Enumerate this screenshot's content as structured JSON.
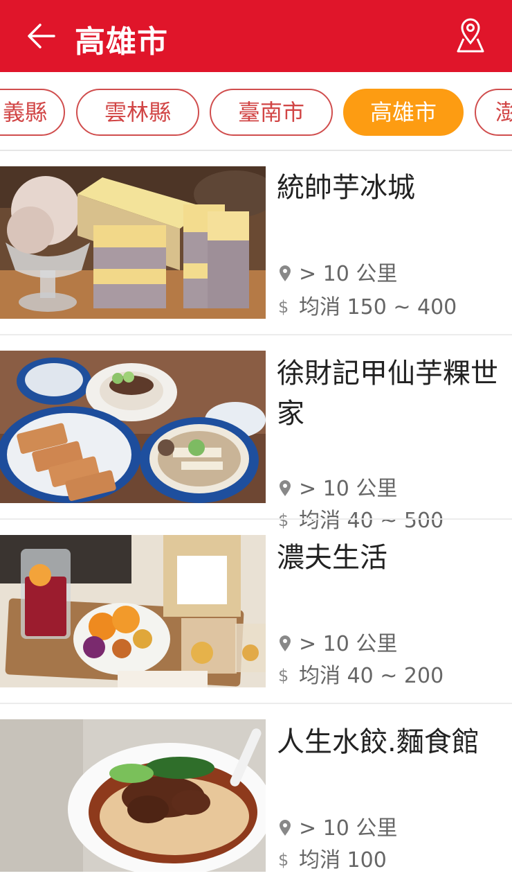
{
  "header": {
    "title": "高雄市",
    "back_icon": "arrow-left-icon",
    "map_icon": "map-pin-icon"
  },
  "colors": {
    "header_bg": "#e0152a",
    "chip_border": "#d04d4d",
    "chip_text": "#d14545",
    "chip_active_bg": "#fd9c12"
  },
  "chips": [
    {
      "label": "義縣",
      "active": false
    },
    {
      "label": "雲林縣",
      "active": false
    },
    {
      "label": "臺南市",
      "active": false
    },
    {
      "label": "高雄市",
      "active": true
    },
    {
      "label": "澎",
      "active": false
    }
  ],
  "shops": [
    {
      "name": "統帥芋冰城",
      "distance": "> 10 公里",
      "price": "均消 150 ~ 400",
      "image": "taro-ice-cream-cake-photo"
    },
    {
      "name": "徐財記甲仙芋粿世家",
      "distance": "> 10 公里",
      "price": "均消 40 ~ 500",
      "image": "taro-cake-meal-photo"
    },
    {
      "name": "濃夫生活",
      "distance": "> 10 公里",
      "price": "均消 40 ~ 200",
      "image": "dried-fruit-tea-photo"
    },
    {
      "name": "人生水餃.麵食館",
      "distance": "> 10 公里",
      "price": "均消 100",
      "image": "beef-noodle-soup-photo"
    }
  ]
}
